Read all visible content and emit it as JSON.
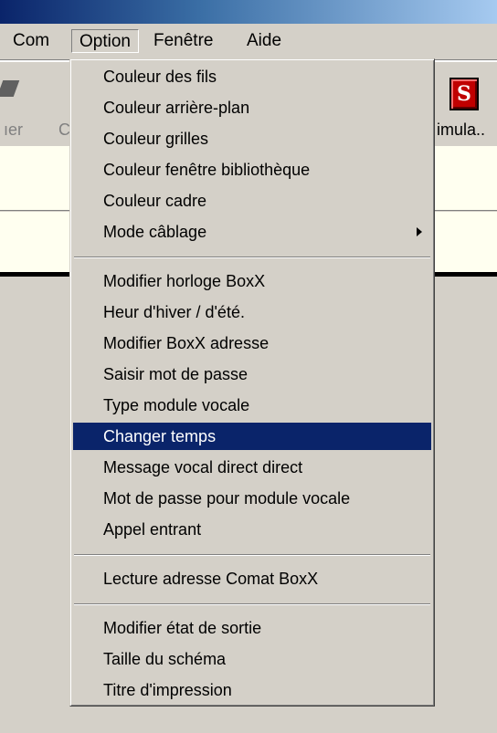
{
  "menubar": {
    "com": "Com",
    "option": "Option",
    "fenetre": "Fenêtre",
    "aide": "Aide"
  },
  "toolbar": {
    "partial_left": "ıer",
    "partial_left2": "C",
    "simulate_label": "imula..",
    "simulate_icon_letter": "S"
  },
  "option_menu": {
    "group1": [
      {
        "label": "Couleur des fils"
      },
      {
        "label": "Couleur arrière-plan"
      },
      {
        "label": "Couleur grilles"
      },
      {
        "label": "Couleur fenêtre bibliothèque"
      },
      {
        "label": "Couleur cadre"
      },
      {
        "label": "Mode câblage",
        "submenu": true
      }
    ],
    "group2": [
      {
        "label": "Modifier horloge BoxX"
      },
      {
        "label": "Heur d'hiver / d'été."
      },
      {
        "label": "Modifier BoxX adresse"
      },
      {
        "label": "Saisir mot de passe"
      },
      {
        "label": "Type module vocale"
      },
      {
        "label": "Changer temps",
        "highlighted": true
      },
      {
        "label": "Message vocal direct direct"
      },
      {
        "label": "Mot de passe pour module vocale"
      },
      {
        "label": "Appel entrant"
      }
    ],
    "group3": [
      {
        "label": "Lecture adresse Comat BoxX"
      }
    ],
    "group4": [
      {
        "label": "Modifier état de sortie"
      },
      {
        "label": "Taille du schéma"
      },
      {
        "label": "Titre d'impression"
      }
    ]
  },
  "colors": {
    "highlight": "#0a246a",
    "face": "#d4d0c8"
  }
}
